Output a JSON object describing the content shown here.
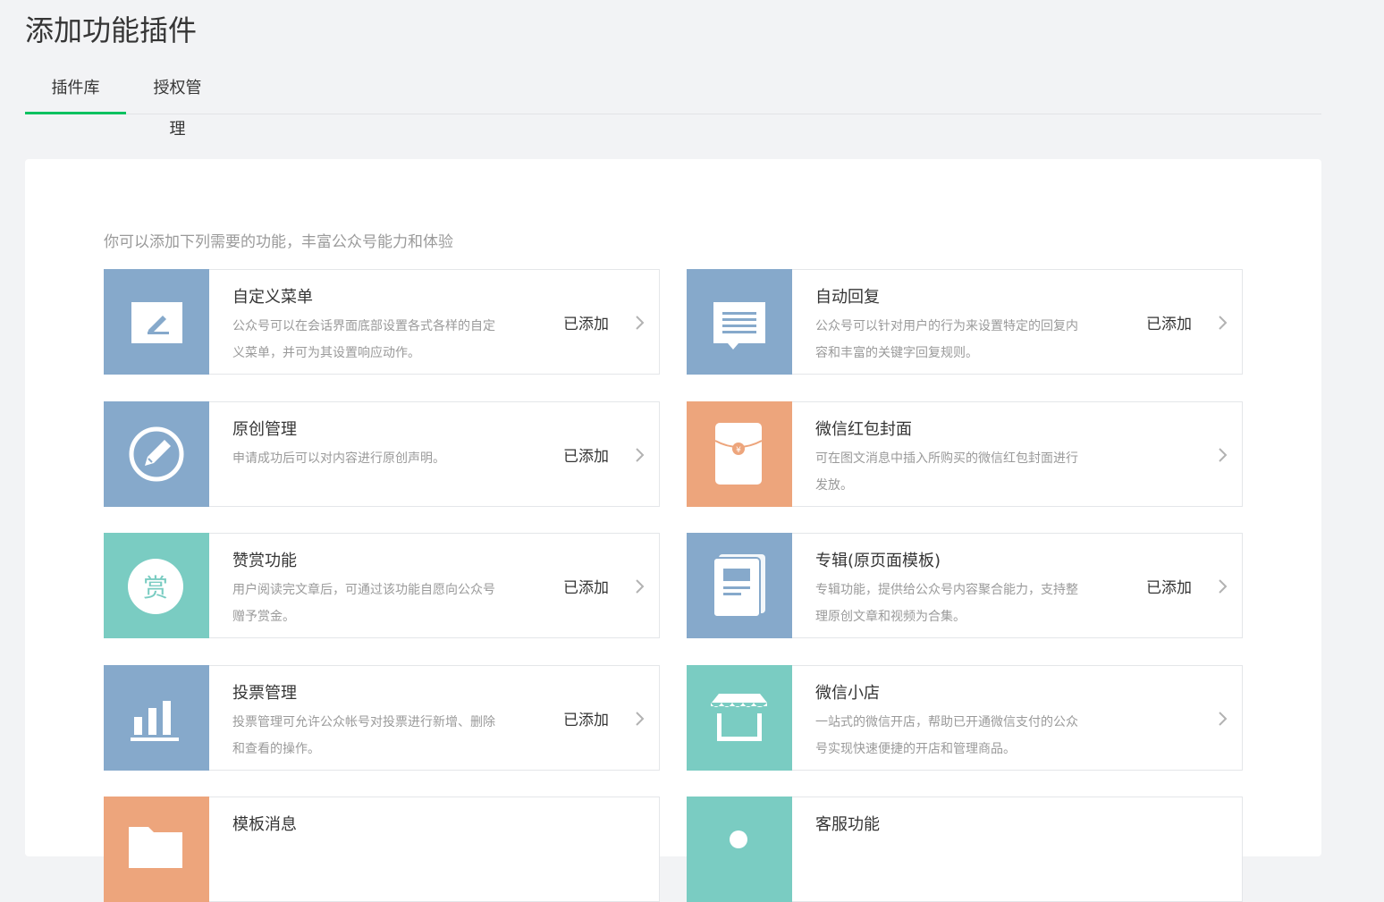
{
  "page": {
    "title": "添加功能插件"
  },
  "tabs": [
    {
      "label": "插件库",
      "active": true
    },
    {
      "label": "授权管理",
      "active": false
    }
  ],
  "intro": "你可以添加下列需要的功能，丰富公众号能力和体验",
  "colors": {
    "accent": "#07c160",
    "blue": "#86a9cb",
    "orange": "#eda57c",
    "teal": "#7accc2"
  },
  "plugins": [
    {
      "title": "自定义菜单",
      "desc": "公众号可以在会话界面底部设置各式各样的自定义菜单，并可为其设置响应动作。",
      "status": "已添加",
      "icon": "edit-icon",
      "color": "blue"
    },
    {
      "title": "自动回复",
      "desc": "公众号可以针对用户的行为来设置特定的回复内容和丰富的关键字回复规则。",
      "status": "已添加",
      "icon": "message-icon",
      "color": "blue"
    },
    {
      "title": "原创管理",
      "desc": "申请成功后可以对内容进行原创声明。",
      "status": "已添加",
      "icon": "original-pen-icon",
      "color": "blue"
    },
    {
      "title": "微信红包封面",
      "desc": "可在图文消息中插入所购买的微信红包封面进行发放。",
      "status": "",
      "icon": "red-packet-icon",
      "color": "orange"
    },
    {
      "title": "赞赏功能",
      "desc": "用户阅读完文章后，可通过该功能自愿向公众号赠予赏金。",
      "status": "已添加",
      "icon": "reward-icon",
      "color": "teal",
      "icon_text": "赏"
    },
    {
      "title": "专辑(原页面模板)",
      "desc": "专辑功能，提供给公众号内容聚合能力，支持整理原创文章和视频为合集。",
      "status": "已添加",
      "icon": "album-icon",
      "color": "blue"
    },
    {
      "title": "投票管理",
      "desc": "投票管理可允许公众帐号对投票进行新增、删除和查看的操作。",
      "status": "已添加",
      "icon": "bar-chart-icon",
      "color": "blue"
    },
    {
      "title": "微信小店",
      "desc": "一站式的微信开店，帮助已开通微信支付的公众号实现快速便捷的开店和管理商品。",
      "status": "",
      "icon": "store-icon",
      "color": "teal"
    },
    {
      "title": "模板消息",
      "desc": "",
      "status": "",
      "icon": "template-icon",
      "color": "orange"
    },
    {
      "title": "客服功能",
      "desc": "",
      "status": "",
      "icon": "service-icon",
      "color": "teal"
    }
  ]
}
